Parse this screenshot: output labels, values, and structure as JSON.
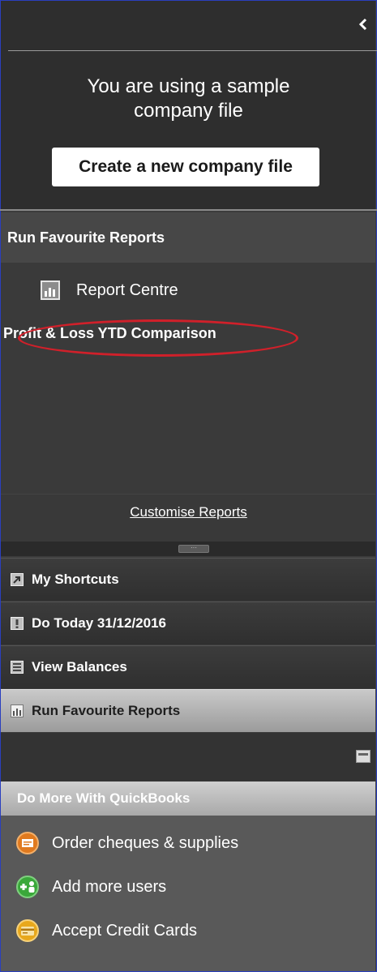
{
  "top": {
    "message": "You are using a sample company file",
    "create_button": "Create a new company file"
  },
  "favourite_reports": {
    "header": "Run Favourite Reports",
    "report_centre": "Report Centre",
    "report_link": "Profit & Loss YTD Comparison",
    "customise": "Customise Reports"
  },
  "nav": {
    "items": [
      {
        "label": "My Shortcuts",
        "icon": "shortcut-arrow-icon"
      },
      {
        "label": "Do Today 31/12/2016",
        "icon": "exclamation-icon"
      },
      {
        "label": "View Balances",
        "icon": "balances-icon"
      },
      {
        "label": "Run Favourite Reports",
        "icon": "bar-chart-icon",
        "active": true
      }
    ]
  },
  "do_more": {
    "header": "Do More With QuickBooks",
    "items": [
      {
        "label": "Order cheques & supplies",
        "icon": "cheque-icon",
        "color": "#e07a1f"
      },
      {
        "label": "Add more users",
        "icon": "add-user-icon",
        "color": "#3aa83a"
      },
      {
        "label": "Accept Credit Cards",
        "icon": "credit-card-icon",
        "color": "#e8a81c"
      }
    ]
  },
  "colors": {
    "annotation_red": "#d0202a",
    "frame_blue": "#2a3fbf"
  }
}
